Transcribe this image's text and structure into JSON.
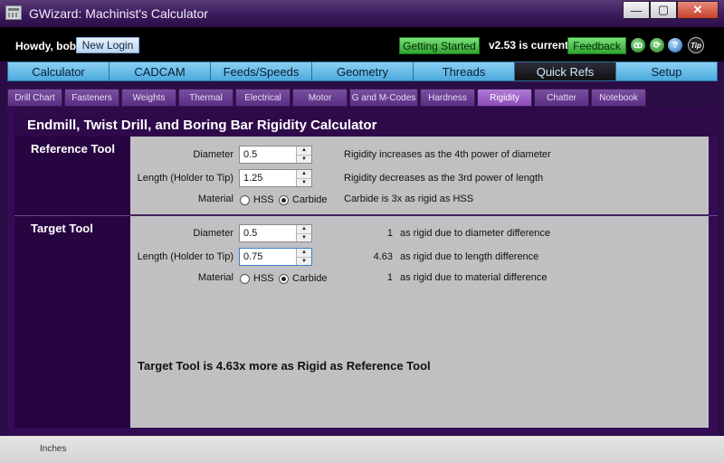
{
  "window": {
    "title": "GWizard: Machinist's Calculator",
    "min": "—",
    "max": "▢",
    "close": "✕"
  },
  "header": {
    "greeting": "Howdy, bob!",
    "new_login": "New Login",
    "getting_started": "Getting Started",
    "version": "v2.53 is current",
    "feedback": "Feedback",
    "icons": [
      {
        "name": "forum-icon",
        "glyph": "ꝏ"
      },
      {
        "name": "refresh-icon",
        "glyph": "⟳"
      },
      {
        "name": "help-icon",
        "glyph": "?"
      },
      {
        "name": "tip-icon",
        "glyph": "Tip"
      }
    ]
  },
  "main_tabs": [
    "Calculator",
    "CADCAM",
    "Feeds/Speeds",
    "Geometry",
    "Threads",
    "Quick Refs",
    "Setup"
  ],
  "active_main_tab": "Quick Refs",
  "sub_tabs": [
    "Drill Chart",
    "Fasteners",
    "Weights",
    "Thermal",
    "Electrical",
    "Motor",
    "G and M-Codes",
    "Hardness",
    "Rigidity",
    "Chatter",
    "Notebook"
  ],
  "active_sub_tab": "Rigidity",
  "page": {
    "title": "Endmill, Twist Drill, and Boring Bar Rigidity Calculator",
    "reference": {
      "section": "Reference Tool",
      "diameter_label": "Diameter",
      "diameter_value": "0.5",
      "length_label": "Length (Holder to Tip)",
      "length_value": "1.25",
      "material_label": "Material",
      "hss": "HSS",
      "carbide": "Carbide",
      "material_selected": "Carbide",
      "note_diameter": "Rigidity increases as the 4th power of diameter",
      "note_length": "Rigidity decreases as the 3rd power of length",
      "note_material": "Carbide is 3x as rigid as HSS"
    },
    "target": {
      "section": "Target Tool",
      "diameter_label": "Diameter",
      "diameter_value": "0.5",
      "length_label": "Length (Holder to Tip)",
      "length_value": "0.75",
      "material_label": "Material",
      "hss": "HSS",
      "carbide": "Carbide",
      "material_selected": "Carbide",
      "diameter_factor": "1",
      "diameter_note": "as rigid due to diameter difference",
      "length_factor": "4.63",
      "length_note": "as rigid due to length difference",
      "material_factor": "1",
      "material_note": "as rigid due to material difference"
    },
    "result": "Target Tool is 4.63x more as Rigid as Reference Tool"
  },
  "status": {
    "units": "Inches"
  }
}
